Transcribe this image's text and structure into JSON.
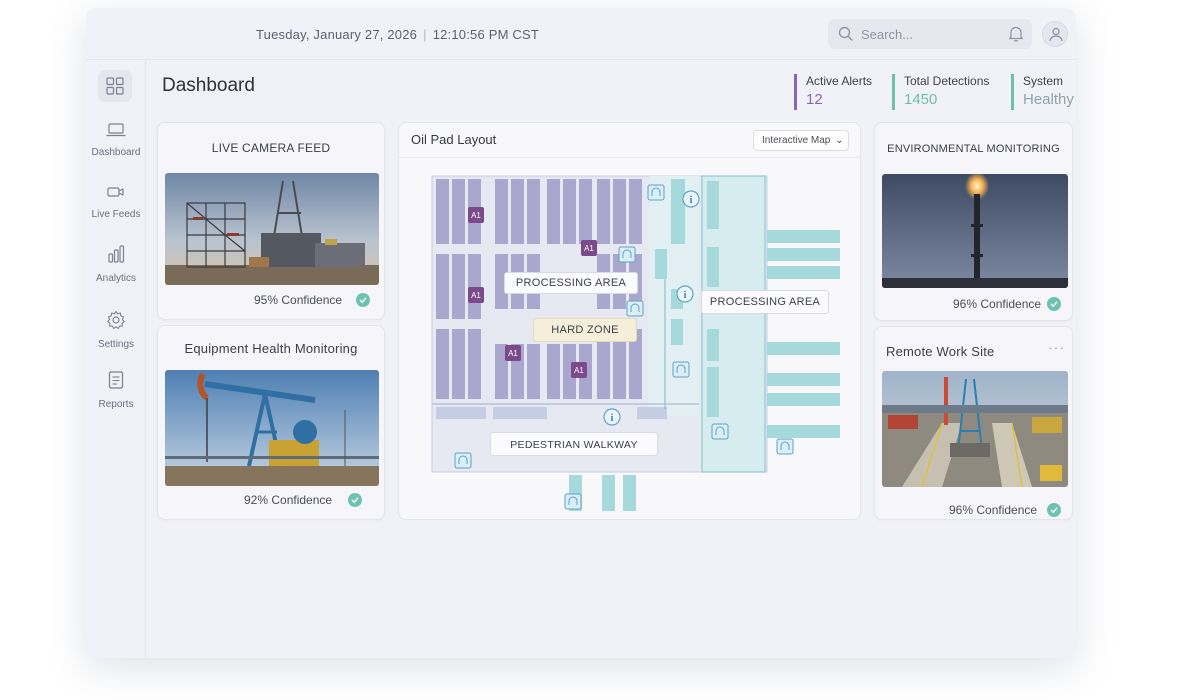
{
  "header": {
    "date": "Tuesday, January 27, 2026",
    "separator": "|",
    "time": "12:10:56 PM CST",
    "search_placeholder": "Search...",
    "icons": [
      "search-icon",
      "bell-icon",
      "user-icon"
    ]
  },
  "sidebar": {
    "logo_icon": "grid-icon",
    "items": [
      {
        "label": "Dashboard",
        "icon": "laptop-icon"
      },
      {
        "label": "Live Feeds",
        "icon": "video-icon"
      },
      {
        "label": "Analytics",
        "icon": "bar-chart-icon"
      },
      {
        "label": "Settings",
        "icon": "gear-icon"
      },
      {
        "label": "Reports",
        "icon": "document-icon"
      }
    ]
  },
  "page": {
    "title": "Dashboard"
  },
  "stats": [
    {
      "label": "Active Alerts",
      "value": "12",
      "color": "#8a65b0"
    },
    {
      "label": "Total Detections",
      "value": "1450",
      "color": "#6fbfad"
    },
    {
      "label": "System",
      "value": "Healthy",
      "color": "#6fbfad"
    }
  ],
  "cards": {
    "live_camera": {
      "title": "LIVE CAMERA FEED",
      "confidence": "95% Confidence"
    },
    "equipment": {
      "title": "Equipment Health Monitoring",
      "confidence": "92% Confidence"
    },
    "environmental": {
      "title": "ENVIRONMENTAL MONITORING",
      "confidence": "96% Confidence"
    },
    "remote_site": {
      "title": "Remote Work Site",
      "more": "···",
      "confidence": "96% Confidence"
    }
  },
  "map": {
    "title": "Oil Pad Layout",
    "select_value": "Interactive Map",
    "chevron": "⌄",
    "labels": {
      "processing_area_1": "PROCESSING AREA",
      "processing_area_2": "PROCESSING AREA",
      "hard_zone": "HARD ZONE",
      "walkway": "PEDESTRIAN WALKWAY"
    },
    "markers": [
      "A1",
      "A1",
      "A1",
      "A1",
      "A1"
    ],
    "info_icon_text": "i",
    "colors": {
      "zone_purple": "#a8a6cc",
      "zone_teal": "#9fd6d8",
      "marker": "#7b4a8a"
    }
  }
}
